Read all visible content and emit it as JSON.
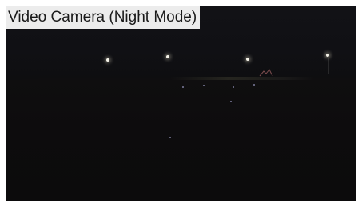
{
  "camera": {
    "title": "Video Camera (Night Mode)",
    "mode": "night"
  },
  "colors": {
    "frame_background": "#0d0c0d",
    "label_background": "#ececec",
    "label_text": "#1a1a1a",
    "light_color": "#f4f2e8"
  }
}
